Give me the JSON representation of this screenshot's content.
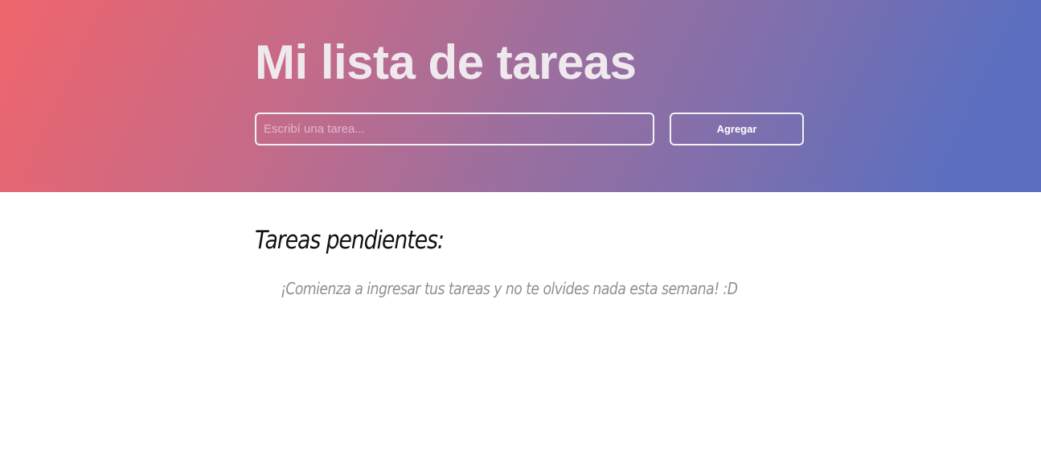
{
  "header": {
    "title": "Mi lista de tareas",
    "input": {
      "value": "",
      "placeholder": "Escribí una tarea..."
    },
    "add_button_label": "Agregar"
  },
  "tasks": {
    "section_title": "Tareas pendientes:",
    "empty_message": "¡Comienza a ingresar tus tareas y no te olvides nada esta semana! :D",
    "items": []
  },
  "colors": {
    "gradient_start": "#f0656c",
    "gradient_end": "#5a6fc0",
    "title_text": "#efe9ee",
    "empty_message_text": "#8a9192"
  }
}
